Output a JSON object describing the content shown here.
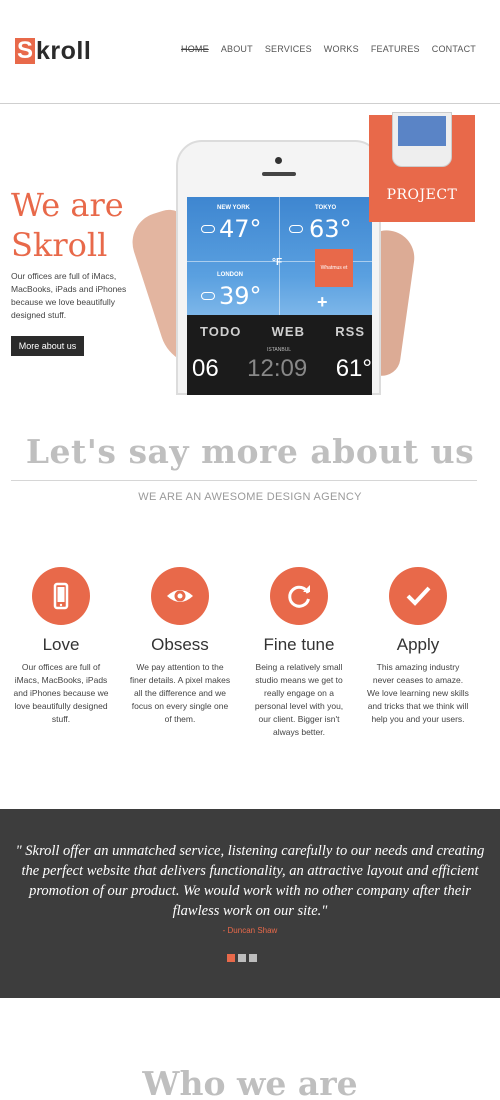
{
  "header": {
    "logo_letter": "S",
    "logo_rest": "kroll",
    "nav": [
      {
        "label": "HOME",
        "active": true
      },
      {
        "label": "ABOUT",
        "active": false
      },
      {
        "label": "SERVICES",
        "active": false
      },
      {
        "label": "WORKS",
        "active": false
      },
      {
        "label": "FEATURES",
        "active": false
      },
      {
        "label": "CONTACT",
        "active": false
      }
    ]
  },
  "hero": {
    "title_line1": "We are",
    "title_line2": "Skroll",
    "text": "Our offices are full of iMacs, MacBooks, iPads and iPhones because we love beautifully designed stuff.",
    "button": "More about us",
    "phone": {
      "city1": "NEW YORK",
      "temp1": "47°",
      "city2": "TOKYO",
      "temp2": "63°",
      "city3": "LONDON",
      "temp3": "39°",
      "unit": "°F",
      "tile_text": "Whatmus et",
      "plus": "+",
      "band_words": [
        "TODO",
        "WEB",
        "RSS"
      ],
      "istanbul": "ISTANBUL",
      "time_left": "06",
      "time_mid": "12:09",
      "time_right": "61°"
    },
    "project_label": "PROJECT"
  },
  "about": {
    "title": "Let's say more about us",
    "subtitle": "WE ARE AN AWESOME DESIGN AGENCY"
  },
  "features": [
    {
      "icon": "smartphone-icon",
      "title": "Love",
      "text": "Our offices are full of iMacs, MacBooks, iPads and iPhones because we love beautifully designed stuff."
    },
    {
      "icon": "eye-icon",
      "title": "Obsess",
      "text": "We pay attention to the finer details. A pixel makes all the difference and we focus on every single one of them."
    },
    {
      "icon": "refresh-icon",
      "title": "Fine tune",
      "text": "Being a relatively small studio means we get to really engage on a personal level with you, our client. Bigger isn't always better."
    },
    {
      "icon": "checkmark-icon",
      "title": "Apply",
      "text": "This amazing industry never ceases to amaze. We love learning new skills and tricks that we think will help you and your users."
    }
  ],
  "testimonial": {
    "quote": "\" Skroll offer an unmatched service, listening carefully to our needs and creating the perfect website that delivers functionality, an attractive layout and efficient promotion of our product. We would work with no other company after their flawless work on our site.\"",
    "author": "- Duncan Shaw",
    "dots": 3,
    "active_dot": 0
  },
  "who": {
    "title": "Who we are"
  },
  "colors": {
    "accent": "#e8694a",
    "dark": "#3d3d3d"
  }
}
